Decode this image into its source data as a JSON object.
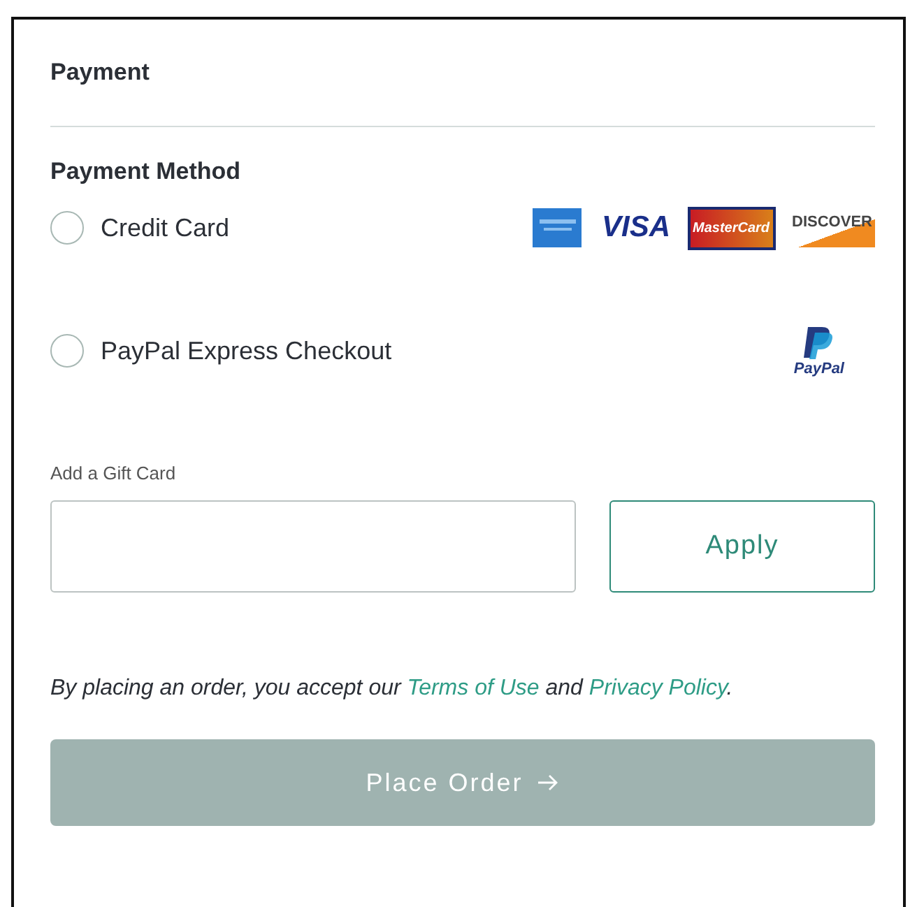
{
  "section_title": "Payment",
  "payment_method": {
    "heading": "Payment Method",
    "options": [
      {
        "label": "Credit Card",
        "selected": false,
        "kind": "cards",
        "logos": [
          "VISA",
          "MasterCard",
          "DISCOVER"
        ]
      },
      {
        "label": "PayPal Express Checkout",
        "selected": false,
        "kind": "paypal",
        "logos": [
          "PayPal"
        ]
      }
    ]
  },
  "gift_card": {
    "label": "Add a Gift Card",
    "button": "Apply"
  },
  "terms": "By placing an order, you accept our ",
  "terms_link_1": "Terms of Use",
  "terms_middle": " and ",
  "terms_link_2": "Privacy Policy",
  "terms_end": ".",
  "place_order": {
    "label": "Place Order",
    "disabled": true
  }
}
